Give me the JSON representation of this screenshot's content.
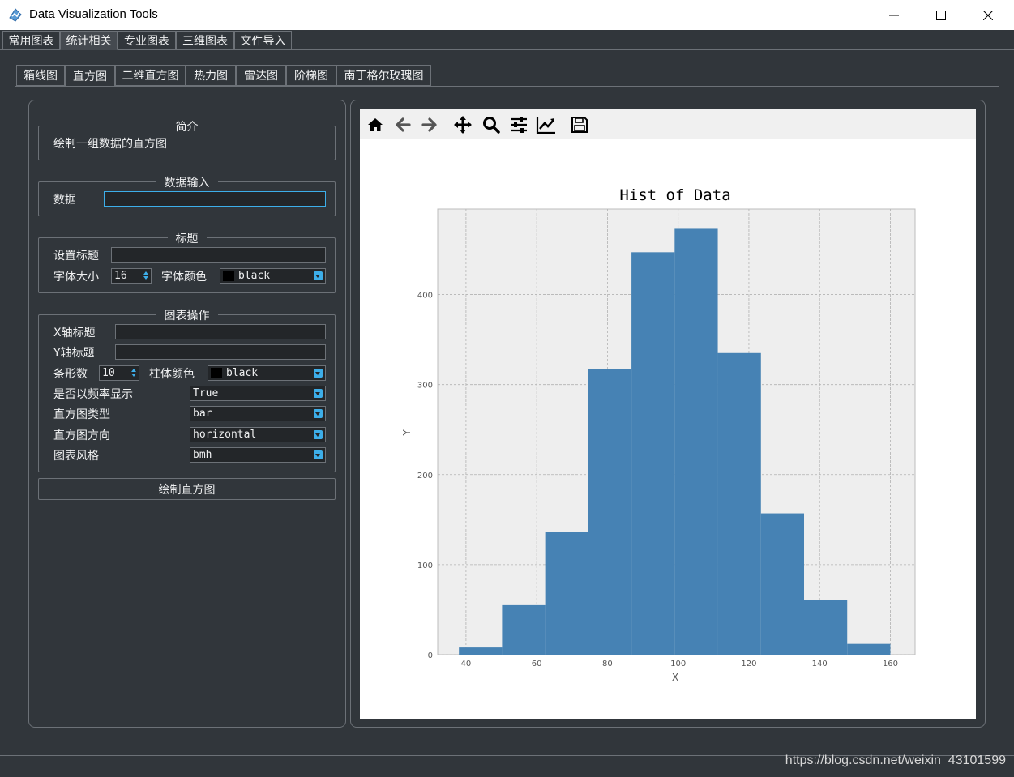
{
  "window": {
    "title": "Data Visualization Tools",
    "minimize_glyph": "—",
    "maximize_glyph": "☐",
    "close_glyph": "✕"
  },
  "outer_tabs": [
    {
      "label": "常用图表",
      "selected": false
    },
    {
      "label": "统计相关",
      "selected": true
    },
    {
      "label": "专业图表",
      "selected": false
    },
    {
      "label": "三维图表",
      "selected": false
    },
    {
      "label": "文件导入",
      "selected": false
    }
  ],
  "inner_tabs": [
    {
      "label": "箱线图",
      "selected": false
    },
    {
      "label": "直方图",
      "selected": true
    },
    {
      "label": "二维直方图",
      "selected": false
    },
    {
      "label": "热力图",
      "selected": false
    },
    {
      "label": "雷达图",
      "selected": false
    },
    {
      "label": "阶梯图",
      "selected": false
    },
    {
      "label": "南丁格尔玫瑰图",
      "selected": false
    }
  ],
  "intro": {
    "title": "简介",
    "text": "绘制一组数据的直方图"
  },
  "data_input": {
    "title": "数据输入",
    "label": "数据",
    "value": ""
  },
  "title_group": {
    "title": "标题",
    "set_title_label": "设置标题",
    "set_title_value": "",
    "font_size_label": "字体大小",
    "font_size_value": "16",
    "font_color_label": "字体颜色",
    "font_color_value": "black",
    "font_color_swatch": "#000000"
  },
  "chart_ops": {
    "title": "图表操作",
    "x_title_label": "X轴标题",
    "x_title_value": "",
    "y_title_label": "Y轴标题",
    "y_title_value": "",
    "bins_label": "条形数",
    "bins_value": "10",
    "bar_color_label": "柱体颜色",
    "bar_color_value": "black",
    "density_label": "是否以频率显示",
    "density_value": "True",
    "histtype_label": "直方图类型",
    "histtype_value": "bar",
    "orientation_label": "直方图方向",
    "orientation_value": "horizontal",
    "style_label": "图表风格",
    "style_value": "bmh"
  },
  "draw_button": "绘制直方图",
  "toolbar_icons": [
    "home-icon",
    "back-arrow-icon",
    "forward-arrow-icon",
    "pan-icon",
    "zoom-icon",
    "configure-subplots-icon",
    "edit-axes-icon",
    "save-icon"
  ],
  "colors": {
    "bar": "#4682b4",
    "plot_bg": "#eeeeee",
    "accent": "#3daee9"
  },
  "chart_data": {
    "type": "bar",
    "title": "Hist of Data",
    "xlabel": "X",
    "ylabel": "Y",
    "bin_edges": [
      38,
      50.2,
      62.4,
      74.6,
      86.8,
      99,
      111.2,
      123.4,
      135.6,
      147.8,
      160
    ],
    "values": [
      8,
      55,
      136,
      317,
      447,
      473,
      335,
      157,
      61,
      12
    ],
    "xlim": [
      32,
      167
    ],
    "ylim": [
      0,
      495
    ],
    "xticks": [
      40,
      60,
      80,
      100,
      120,
      140,
      160
    ],
    "yticks": [
      0,
      100,
      200,
      300,
      400
    ],
    "grid": true
  },
  "watermark": "https://blog.csdn.net/weixin_43101599"
}
